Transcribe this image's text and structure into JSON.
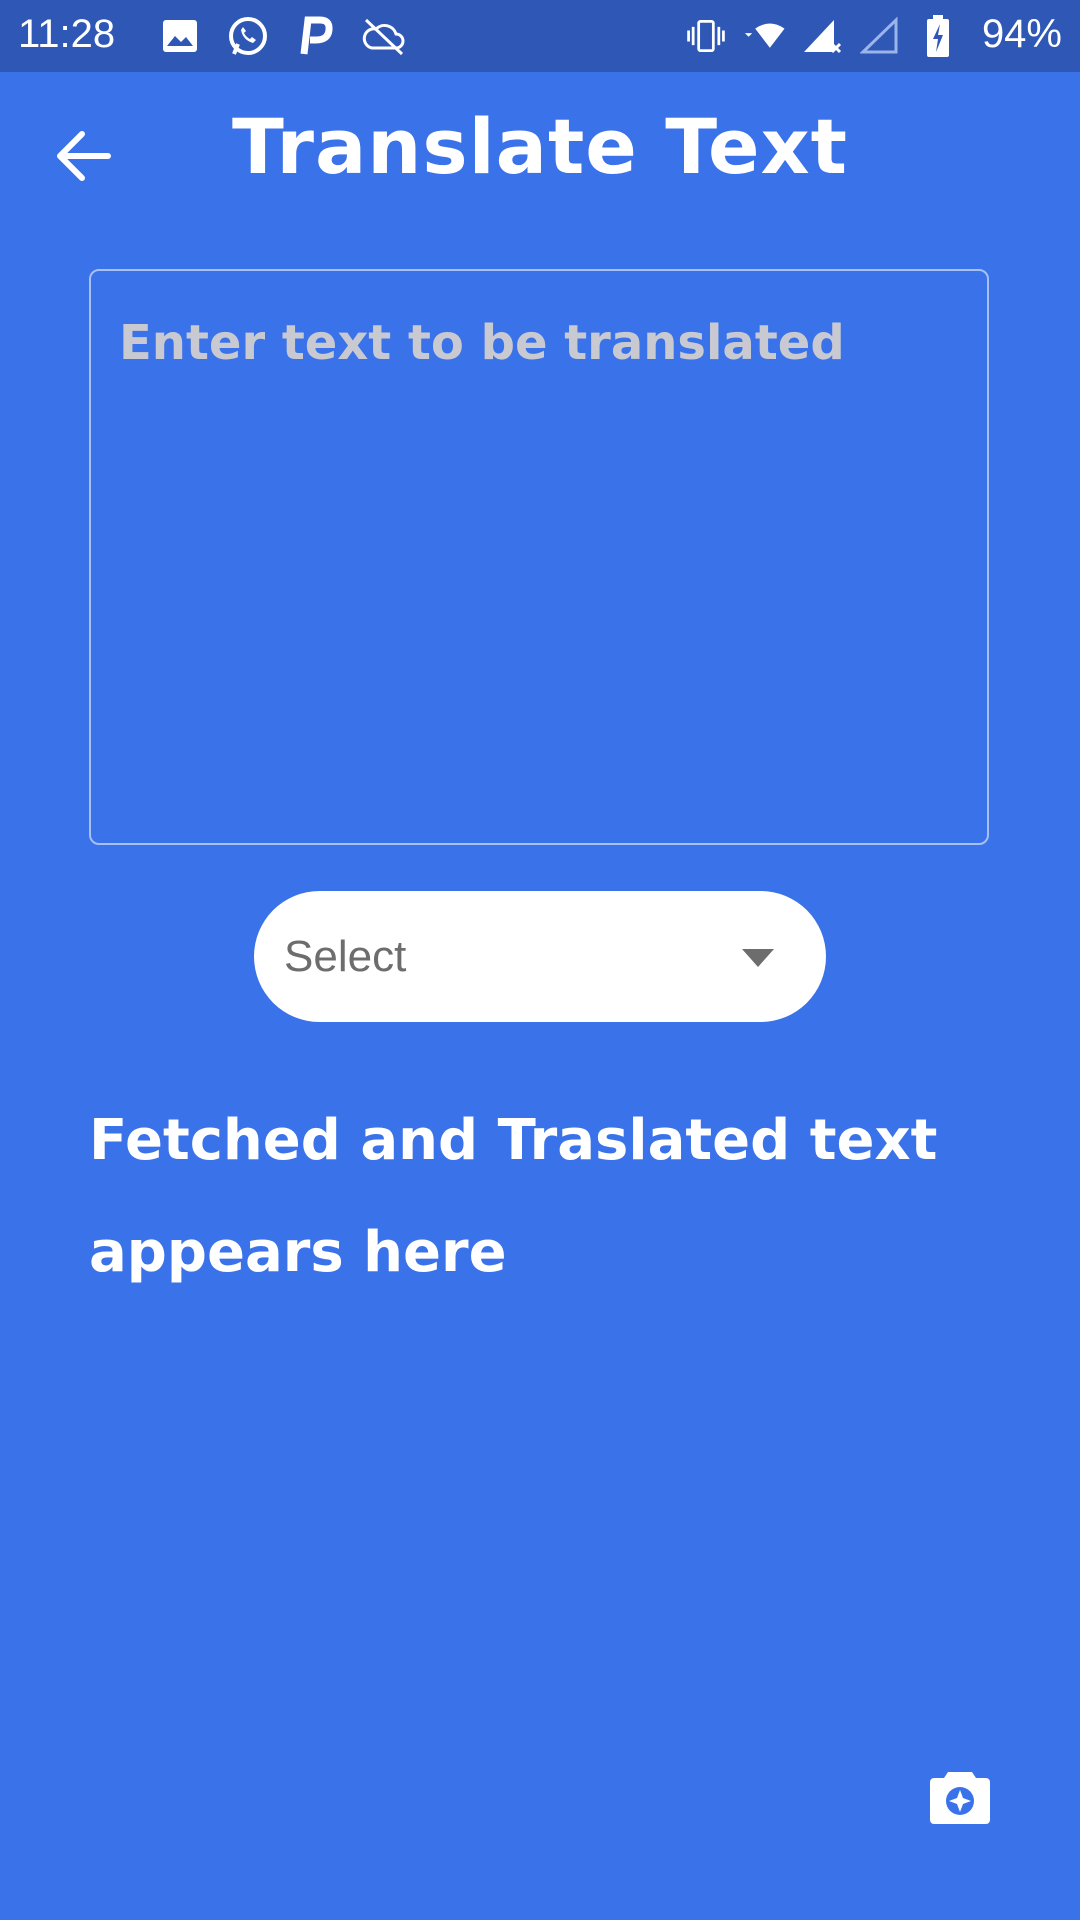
{
  "status_bar": {
    "time": "11:28",
    "battery": "94%",
    "left_icons": [
      "image-icon",
      "whatsapp-icon",
      "p-icon",
      "cloud-off-icon"
    ],
    "right_icons": [
      "vibrate-icon",
      "wifi-icon",
      "signal-icon",
      "signal-empty-icon",
      "battery-icon"
    ]
  },
  "app_bar": {
    "title": "Translate Text",
    "back_icon": "arrow-left-icon"
  },
  "input": {
    "value": "",
    "placeholder": "Enter text to be translated"
  },
  "language_select": {
    "selected": "Select",
    "caret_icon": "caret-down-icon"
  },
  "result": {
    "text": "Fetched and Traslated text appears here"
  },
  "fab": {
    "icon": "camera-icon"
  },
  "colors": {
    "background": "#3a72ea",
    "status_bar": "#2e57b6",
    "text": "#ffffff",
    "placeholder": "#c9cad1"
  }
}
